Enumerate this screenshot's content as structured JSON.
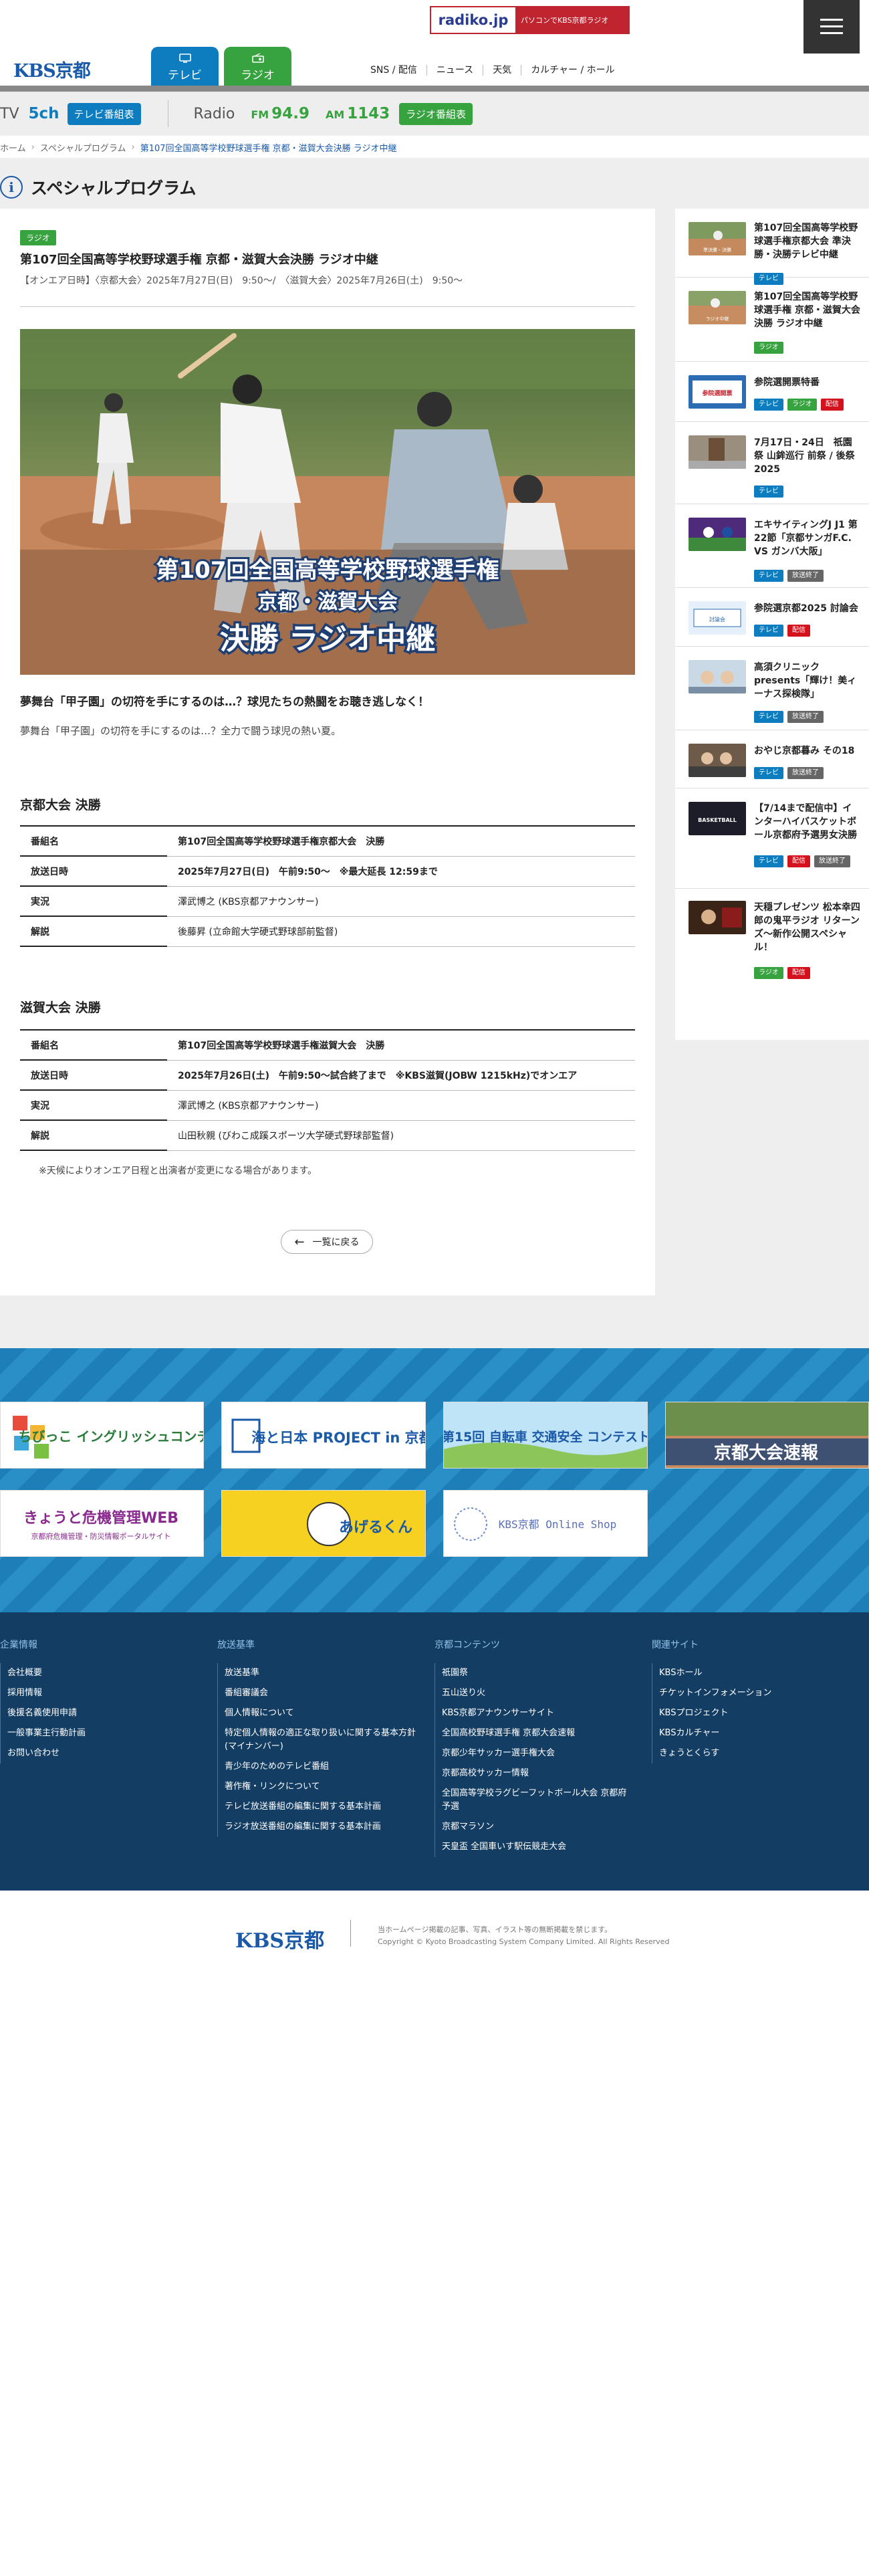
{
  "header": {
    "radiko_logo": "radiko.jp",
    "radiko_caption": "パソコンでKBS京都ラジオ",
    "logo": "KBS京都",
    "tabs": [
      {
        "label": "テレビ",
        "icon": "tv-icon"
      },
      {
        "label": "ラジオ",
        "icon": "radio-icon"
      }
    ],
    "nav": [
      "SNS / 配信",
      "ニュース",
      "天気",
      "カルチャー / ホール"
    ]
  },
  "channel_bar": {
    "tv_label": "TV",
    "tv_channel": "5ch",
    "tv_guide": "テレビ番組表",
    "radio_label": "Radio",
    "fm_label": "FM",
    "fm_freq": "94.9",
    "am_label": "AM",
    "am_freq": "1143",
    "radio_guide": "ラジオ番組表"
  },
  "breadcrumb": {
    "home": "ホーム",
    "parent": "スペシャルプログラム",
    "current": "第107回全国高等学校野球選手権 京都・滋賀大会決勝 ラジオ中継"
  },
  "page_title": "スペシャルプログラム",
  "article": {
    "category": "ラジオ",
    "title": "第107回全国高等学校野球選手権 京都・滋賀大会決勝 ラジオ中継",
    "onair": "【オンエア日時】〈京都大会〉2025年7月27日(日)　9:50〜/　〈滋賀大会〉2025年7月26日(土)　9:50〜",
    "hero_line1": "第107回全国高等学校野球選手権",
    "hero_line2": "京都・滋賀大会",
    "hero_line3": "決勝 ラジオ中継",
    "lead_bold": "夢舞台「甲子園」の切符を手にするのは…？球児たちの熱闘をお聴き逃しなく！",
    "lead": "夢舞台「甲子園」の切符を手にするのは…？全力で闘う球児の熱い夏。",
    "kyoto": {
      "title": "京都大会 決勝",
      "rows": [
        {
          "label": "番組名",
          "value": "第107回全国高等学校野球選手権京都大会　決勝"
        },
        {
          "label": "放送日時",
          "value": "2025年7月27日(日)　午前9:50〜　※最大延長 12:59まで"
        },
        {
          "label": "実況",
          "value": "澤武博之 (KBS京都アナウンサー)"
        },
        {
          "label": "解説",
          "value": "後藤昇 (立命館大学硬式野球部前監督)"
        }
      ]
    },
    "shiga": {
      "title": "滋賀大会 決勝",
      "rows": [
        {
          "label": "番組名",
          "value": "第107回全国高等学校野球選手権滋賀大会　決勝"
        },
        {
          "label": "放送日時",
          "value": "2025年7月26日(土)　午前9:50〜試合終了まで　※KBS滋賀(JOBW 1215kHz)でオンエア"
        },
        {
          "label": "実況",
          "value": "澤武博之 (KBS京都アナウンサー)"
        },
        {
          "label": "解説",
          "value": "山田秋親 (びわこ成蹊スポーツ大学硬式野球部監督)"
        }
      ]
    },
    "note": "※天候によりオンエア日程と出演者が変更になる場合があります。",
    "back_label": "一覧に戻る"
  },
  "sidebar": [
    {
      "title": "第107回全国高等学校野球選手権京都大会 準決勝・決勝テレビ中継",
      "tags": [
        "テレビ"
      ]
    },
    {
      "title": "第107回全国高等学校野球選手権 京都・滋賀大会決勝 ラジオ中継",
      "tags": [
        "ラジオ"
      ]
    },
    {
      "title": "参院選開票特番",
      "tags": [
        "テレビ",
        "ラジオ",
        "配信"
      ]
    },
    {
      "title": "7月17日・24日　祇園祭 山鉾巡行 前祭 / 後祭 2025",
      "tags": [
        "テレビ"
      ]
    },
    {
      "title": "エキサイティングJ J1 第22節「京都サンガF.C. VS ガンバ大阪」",
      "tags": [
        "テレビ",
        "放送終了"
      ]
    },
    {
      "title": "参院選京都2025 討論会",
      "tags": [
        "テレビ",
        "配信"
      ]
    },
    {
      "title": "高須クリニック presents「輝け！美ィーナス探検隊」",
      "tags": [
        "テレビ",
        "放送終了"
      ]
    },
    {
      "title": "おやじ京都暮み その18",
      "tags": [
        "テレビ",
        "放送終了"
      ]
    },
    {
      "title": "【7/14まで配信中】インターハイバスケットボール京都府予選男女決勝",
      "tags": [
        "テレビ",
        "配信",
        "放送終了"
      ]
    },
    {
      "title": "天穏プレゼンツ 松本幸四郎の鬼平ラジオ リターンズ〜新作公開スペシャル！",
      "tags": [
        "ラジオ",
        "配信"
      ]
    }
  ],
  "banners": [
    {
      "text": "ちびっこ イングリッシュコンテスト"
    },
    {
      "text": "海と日本 PROJECT in 京都"
    },
    {
      "text": "第15回 自転車 交通安全 コンテスト"
    },
    {
      "text": "京都大会速報"
    },
    {
      "text": "きょうと危機管理WEB",
      "sub": "京都府危機管理・防災情報ポータルサイト"
    },
    {
      "text": "あげるくん"
    },
    {
      "text": "KBS京都 Online Shop"
    }
  ],
  "footer": {
    "columns": [
      {
        "title": "企業情報",
        "links": [
          "会社概要",
          "採用情報",
          "後援名義使用申請",
          "一般事業主行動計画",
          "お問い合わせ"
        ]
      },
      {
        "title": "放送基準",
        "links": [
          "放送基準",
          "番組審議会",
          "個人情報について",
          "特定個人情報の適正な取り扱いに関する基本方針(マイナンバー)",
          "青少年のためのテレビ番組",
          "著作権・リンクについて",
          "テレビ放送番組の編集に関する基本計画",
          "ラジオ放送番組の編集に関する基本計画"
        ]
      },
      {
        "title": "京都コンテンツ",
        "links": [
          "祇園祭",
          "五山送り火",
          "KBS京都アナウンサーサイト",
          "全国高校野球選手権 京都大会速報",
          "京都少年サッカー選手権大会",
          "京都高校サッカー情報",
          "全国高等学校ラグビーフットボール大会 京都府予選",
          "京都マラソン",
          "天皇盃 全国車いす駅伝競走大会"
        ]
      },
      {
        "title": "関連サイト",
        "links": [
          "KBSホール",
          "チケットインフォメーション",
          "KBSプロジェクト",
          "KBSカルチャー",
          "きょうとくらす"
        ]
      }
    ],
    "logo": "KBS京都",
    "notice": "当ホームページ掲載の記事、写真、イラスト等の無断掲載を禁じます。",
    "copyright": "Copyright © Kyoto Broadcasting System Company Limited. All Rights Reserved"
  }
}
